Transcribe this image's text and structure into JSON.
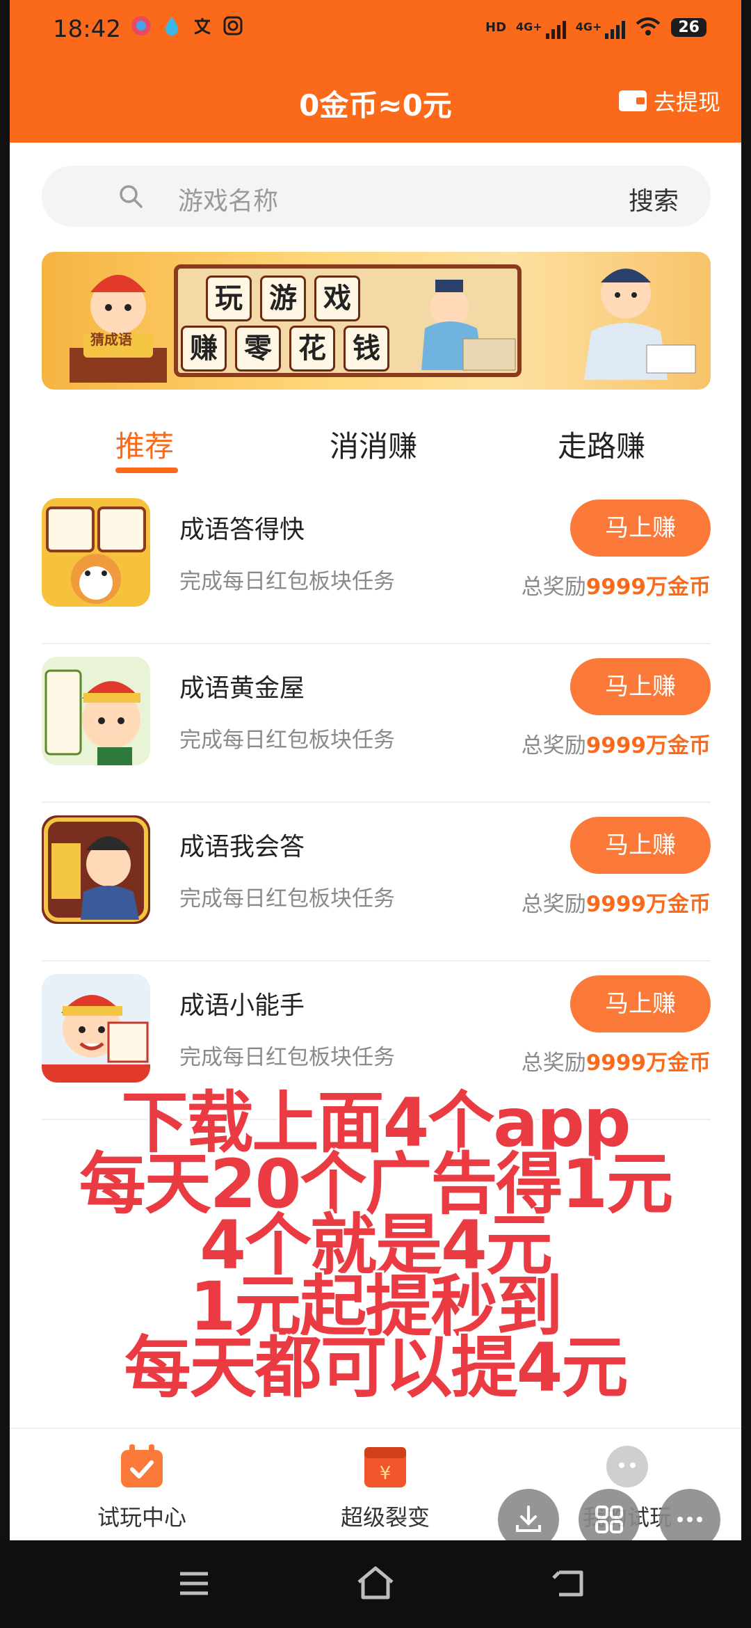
{
  "status_bar": {
    "time": "18:42",
    "signal_label_1": "4G+",
    "signal_label_2": "4G+",
    "hd_label": "HD",
    "battery": "26"
  },
  "header": {
    "coins_text": "0金币≈0元",
    "withdraw_label": "去提现"
  },
  "search": {
    "placeholder": "游戏名称",
    "button_label": "搜索"
  },
  "banner": {
    "tiles_row1": [
      "玩",
      "游",
      "戏"
    ],
    "tiles_row2": [
      "赚",
      "零",
      "花",
      "钱"
    ],
    "badge": "猜成语"
  },
  "tabs": [
    {
      "label": "推荐",
      "active": true
    },
    {
      "label": "消消赚",
      "active": false
    },
    {
      "label": "走路赚",
      "active": false
    }
  ],
  "apps": [
    {
      "title": "成语答得快",
      "desc": "完成每日红包板块任务",
      "button": "马上赚",
      "reward_prefix": "总奖励",
      "reward_value": "9999万金币"
    },
    {
      "title": "成语黄金屋",
      "desc": "完成每日红包板块任务",
      "button": "马上赚",
      "reward_prefix": "总奖励",
      "reward_value": "9999万金币"
    },
    {
      "title": "成语我会答",
      "desc": "完成每日红包板块任务",
      "button": "马上赚",
      "reward_prefix": "总奖励",
      "reward_value": "9999万金币"
    },
    {
      "title": "成语小能手",
      "desc": "完成每日红包板块任务",
      "button": "马上赚",
      "reward_prefix": "总奖励",
      "reward_value": "9999万金币"
    }
  ],
  "promo_lines": [
    "下载上面4个app",
    "每天20个广告得1元",
    "4个就是4元",
    "1元起提秒到",
    "每天都可以提4元"
  ],
  "bottom_nav": [
    {
      "label": "试玩中心"
    },
    {
      "label": "超级裂变"
    },
    {
      "label": "我的试玩"
    }
  ],
  "colors": {
    "brand_orange": "#fb6a1a",
    "button_orange": "#fb7a3a",
    "promo_red": "#ea3a42"
  }
}
